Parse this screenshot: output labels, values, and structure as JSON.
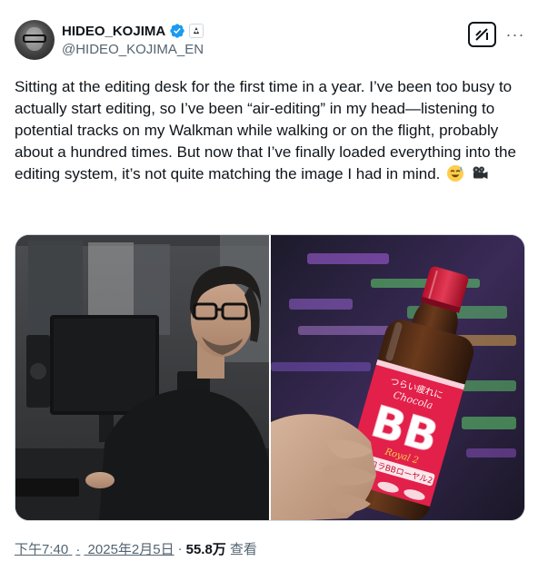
{
  "author": {
    "display_name": "HIDEO_KOJIMA",
    "handle": "@HIDEO_KOJIMA_EN",
    "verified": true,
    "verified_color": "#1d9bf0"
  },
  "actions": {
    "grok_icon": "grok-icon",
    "more_label": "···"
  },
  "tweet": {
    "text": "Sitting at the editing desk for the first time in a year. I’ve been too busy to actually start editing, so I’ve been “air-editing” in my head—listening to potential tracks on my Walkman while walking or on the flight, probably about a hundred times. But now that I’ve finally loaded everything into the editing system, it’s not quite matching the image I had in mind.",
    "emojis": [
      "sweat-smile-emoji",
      "movie-camera-emoji"
    ]
  },
  "media": {
    "images": [
      {
        "name": "photo-editing-desk"
      },
      {
        "name": "photo-chocola-bb-bottle",
        "bottle_labels": [
          "つらい疲れに",
          "Chocola",
          "BB",
          "Royal 2",
          "チョコラBBローヤル2"
        ]
      }
    ]
  },
  "meta": {
    "time": "下午7:40",
    "separator": "·",
    "date": "2025年2月5日",
    "views_count": "55.8万",
    "views_label": "查看"
  },
  "colors": {
    "text_primary": "#0f1419",
    "text_secondary": "#536471",
    "border": "#cfd9de"
  }
}
